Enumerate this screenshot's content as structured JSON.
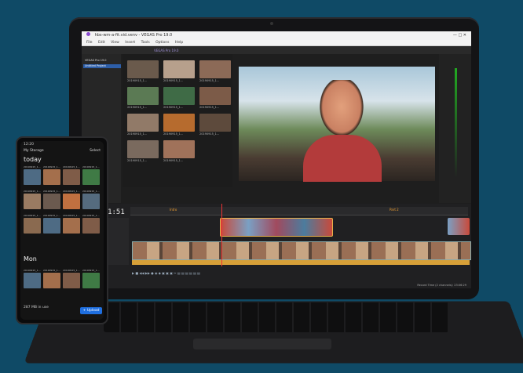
{
  "app": {
    "window_title": "hbs-wm-a-fit.vid.venv  - VEGAS Pro 19.0",
    "menu": [
      "File",
      "Edit",
      "View",
      "Insert",
      "Tools",
      "Options",
      "Help"
    ],
    "project_folder": "VEGAS Pro 19.0",
    "bin_label": "Untitled Project"
  },
  "media": {
    "items": [
      {
        "caption": "20190915_1...",
        "color": "#6a5a4c"
      },
      {
        "caption": "20190915_1...",
        "color": "#b7a08c"
      },
      {
        "caption": "20190915_1...",
        "color": "#8c6a57"
      },
      {
        "caption": "20190915_1...",
        "color": "#5b7a54"
      },
      {
        "caption": "20190915_1...",
        "color": "#3f6b46"
      },
      {
        "caption": "20190915_1...",
        "color": "#7c5b48"
      },
      {
        "caption": "20190915_1...",
        "color": "#917a68"
      },
      {
        "caption": "20190915_1...",
        "color": "#b66b2e"
      },
      {
        "caption": "20190915_1...",
        "color": "#5d4a3c"
      },
      {
        "caption": "20190915_1...",
        "color": "#7a6a5e"
      },
      {
        "caption": "20190915_1...",
        "color": "#a0725a"
      }
    ]
  },
  "timeline": {
    "timecode": "+00:01:51",
    "marker_labels": [
      "Intro",
      "Part 2"
    ],
    "status": "Record Time (2 channels): 23:06:29"
  },
  "phone": {
    "status_time": "12:20",
    "back_label": "My Storage",
    "select_label": "Select",
    "sections": [
      "today",
      "Mon"
    ],
    "file_caption": "20190915_1...",
    "footer": "287 MB in use",
    "upload_button": "+ Upload"
  },
  "colors": {
    "background": "#0f4a66",
    "accent": "#1f6fe0",
    "audio": "#d7a038"
  }
}
